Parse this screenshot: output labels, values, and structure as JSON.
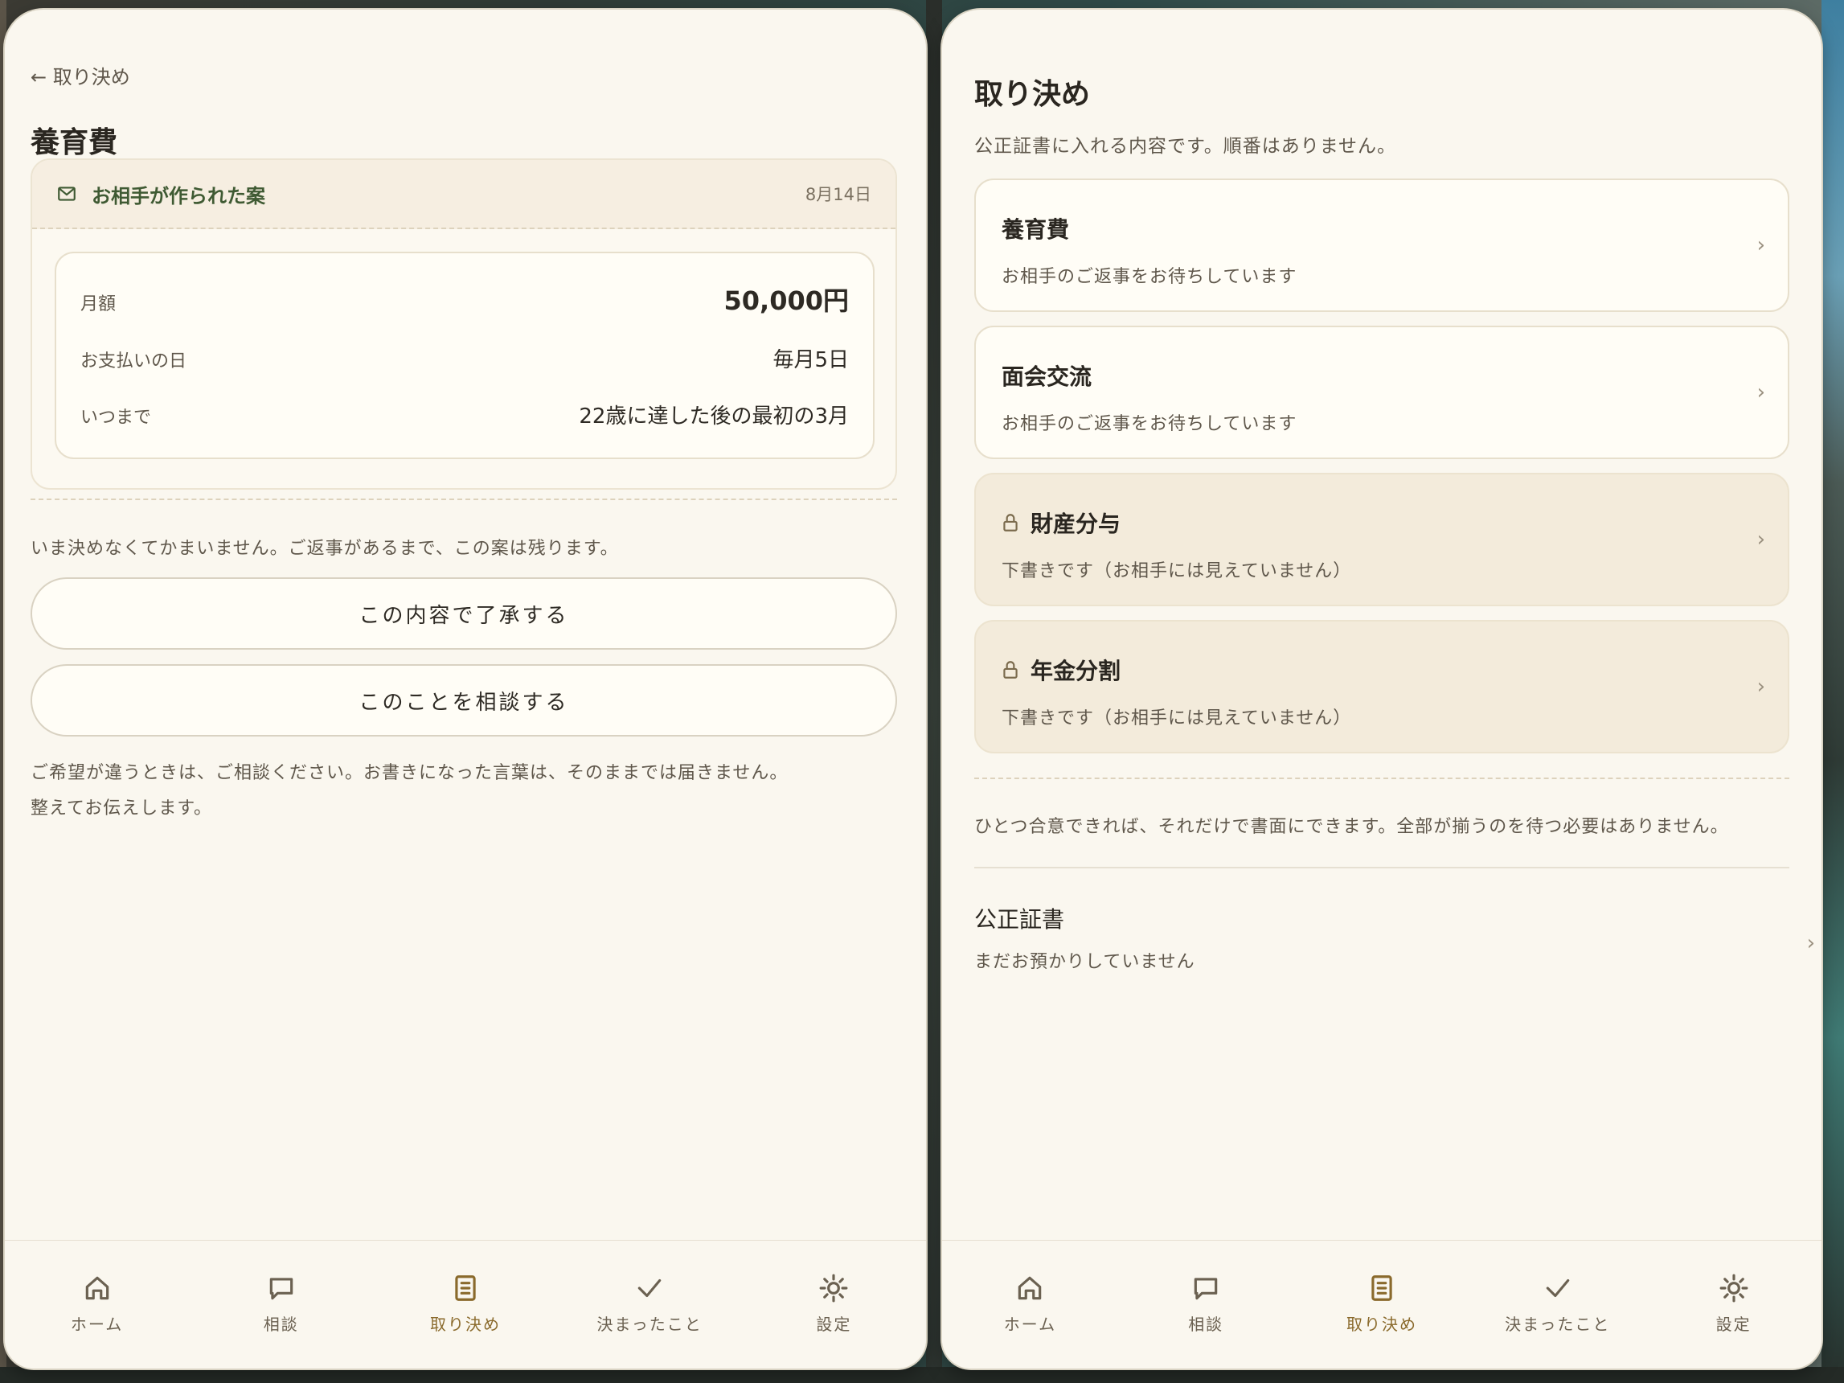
{
  "left": {
    "back_label": "← 取り決め",
    "title": "養育費",
    "proposal": {
      "from": "お相手が作られた案",
      "date": "8月14日",
      "rows": [
        {
          "key": "月額",
          "value": "50,000円"
        },
        {
          "key": "お支払いの日",
          "value": "毎月5日"
        },
        {
          "key": "いつまで",
          "value": "22歳に達した後の最初の3月"
        }
      ]
    },
    "note": "いま決めなくてかまいません。ご返事があるまで、この案は残ります。",
    "accept_label": "この内容で了承する",
    "consult_label": "このことを相談する",
    "footer_line1": "ご希望が違うときは、ご相談ください。お書きになった言葉は、そのままでは届きません。",
    "footer_line2": "整えてお伝えします。"
  },
  "right": {
    "title": "取り決め",
    "subtitle": "公正証書に入れる内容です。順番はありません。",
    "items": [
      {
        "title": "養育費",
        "status": "お相手のご返事をお待ちしています",
        "locked": false
      },
      {
        "title": "面会交流",
        "status": "お相手のご返事をお待ちしています",
        "locked": false
      },
      {
        "title": "財産分与",
        "status": "下書きです（お相手には見えていません）",
        "locked": true
      },
      {
        "title": "年金分割",
        "status": "下書きです（お相手には見えていません）",
        "locked": true
      }
    ],
    "note": "ひとつ合意できれば、それだけで書面にできます。全部が揃うのを待つ必要はありません。",
    "document": {
      "title": "公正証書",
      "status": "まだお預かりしていません"
    }
  },
  "tabs": [
    {
      "label": "ホーム",
      "icon": "home-icon"
    },
    {
      "label": "相談",
      "icon": "chat-icon"
    },
    {
      "label": "取り決め",
      "icon": "document-icon",
      "active": true
    },
    {
      "label": "決まったこと",
      "icon": "check-icon"
    },
    {
      "label": "設定",
      "icon": "sun-gear-icon"
    }
  ],
  "chevron": "›",
  "colors": {
    "background": "#faf7ef",
    "accent": "#8a6a2c",
    "green": "#3f5a33",
    "locked_card": "#f3ebdb"
  }
}
